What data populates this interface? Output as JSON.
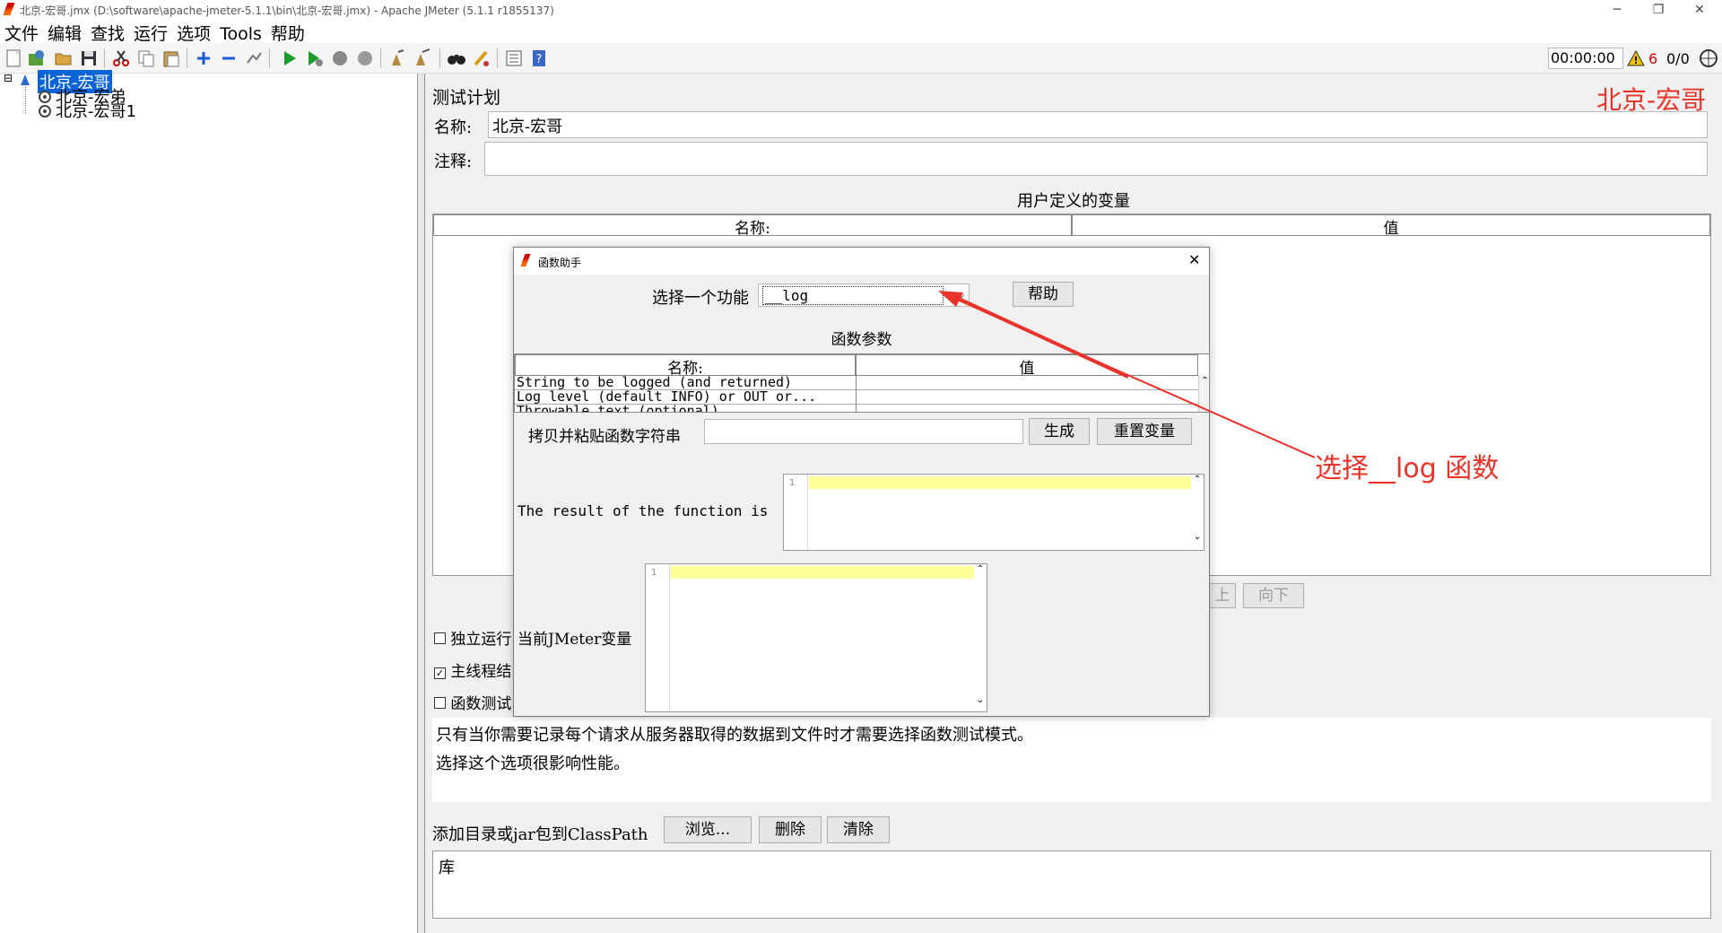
{
  "window": {
    "title": "北京-宏哥.jmx (D:\\software\\apache-jmeter-5.1.1\\bin\\北京-宏哥.jmx) - Apache JMeter (5.1.1 r1855137)"
  },
  "menu": [
    "文件",
    "编辑",
    "查找",
    "运行",
    "选项",
    "Tools",
    "帮助"
  ],
  "toolbar_status": {
    "timer": "00:00:00",
    "warnings": "6",
    "threads": "0/0"
  },
  "tree": {
    "root": "北京-宏哥",
    "children": [
      "北京-宏弟",
      "北京-宏哥1"
    ]
  },
  "test_plan": {
    "heading": "测试计划",
    "name_label": "名称:",
    "name_value": "北京-宏哥",
    "comment_label": "注释:",
    "comment_value": "",
    "vars_title": "用户定义的变量",
    "vars_col_name": "名称:",
    "vars_col_value": "值",
    "btn_up": "上",
    "btn_down": "向下",
    "cb_independent": "独立运行",
    "cb_main_thread": "主线程结",
    "cb_func_test": "函数测试",
    "desc_line1": "只有当你需要记录每个请求从服务器取得的数据到文件时才需要选择函数测试模式。",
    "desc_line2": "选择这个选项很影响性能。",
    "classpath_label": "添加目录或jar包到ClassPath",
    "btn_browse": "浏览...",
    "btn_delete": "删除",
    "btn_clear": "清除",
    "lib_header": "库"
  },
  "dialog": {
    "title": "函数助手",
    "select_label": "选择一个功能",
    "selected_function": "__log",
    "help_button": "帮助",
    "params_title": "函数参数",
    "col_name": "名称:",
    "col_value": "值",
    "params": [
      {
        "name": "String to be logged (and returned)",
        "value": ""
      },
      {
        "name": "Log level (default INFO) or OUT or...",
        "value": ""
      },
      {
        "name": "Throwable text (optional)",
        "value": ""
      }
    ],
    "copy_label": "拷贝并粘贴函数字符串",
    "copy_value": "",
    "generate_button": "生成",
    "reset_button": "重置变量",
    "result_label": "The result of the function is",
    "vars_label": "当前JMeter变量",
    "line_number": "1"
  },
  "annotation": {
    "text": "选择__log 函数",
    "watermark": "北京-宏哥",
    "color": "#e8332a"
  }
}
